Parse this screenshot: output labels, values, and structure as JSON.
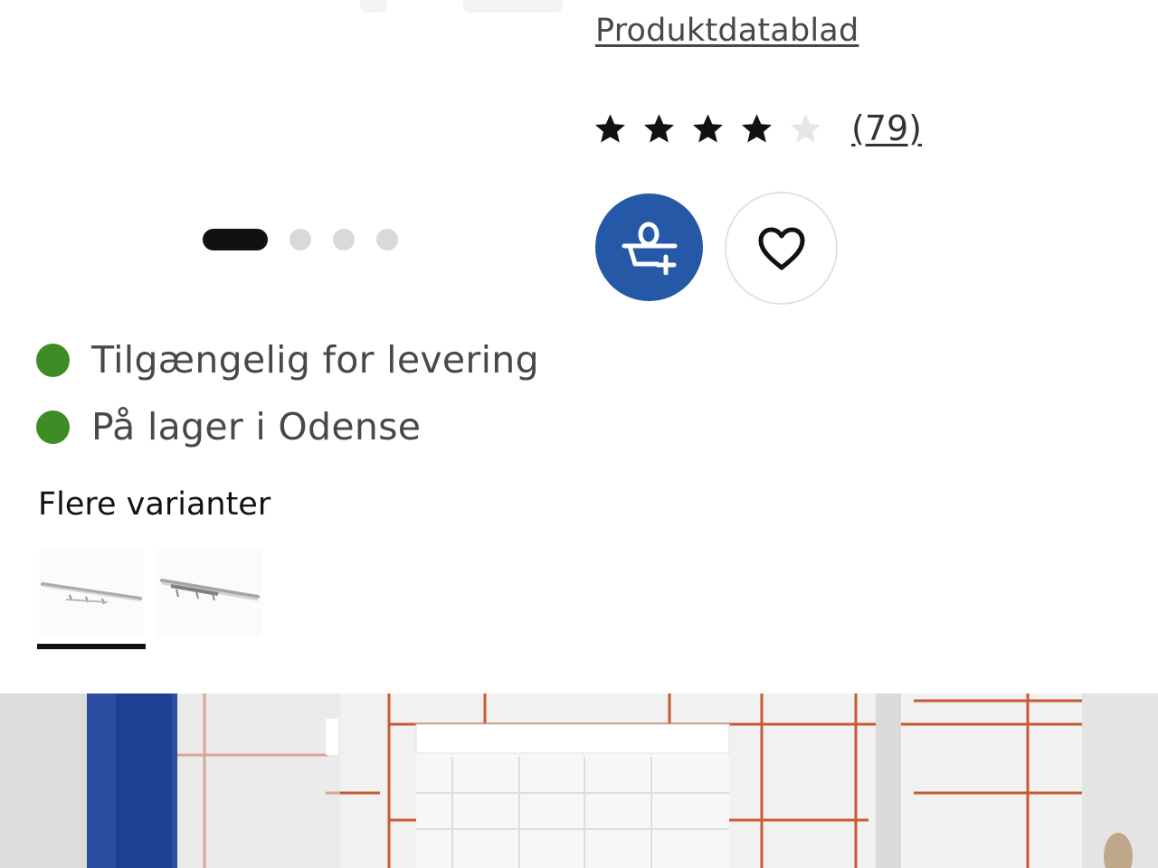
{
  "product": {
    "datasheet_link": "Produktdatablad",
    "rating": 4,
    "rating_max": 5,
    "review_count": "(79)"
  },
  "gallery": {
    "total_images": 4,
    "active_index": 0
  },
  "actions": {
    "add_to_cart_icon": "shopping-bag-add-icon",
    "favorite_icon": "heart-icon"
  },
  "availability": [
    {
      "text": "Tilgængelig for levering",
      "status_color": "#3d8c25"
    },
    {
      "text": "På lager i Odense",
      "status_color": "#3d8c25"
    }
  ],
  "variants": {
    "title": "Flere varianter",
    "selected_index": 0,
    "count": 2
  },
  "colors": {
    "accent_blue": "#2559a8",
    "status_green": "#3d8c25",
    "grout_orange": "#c85a34"
  }
}
